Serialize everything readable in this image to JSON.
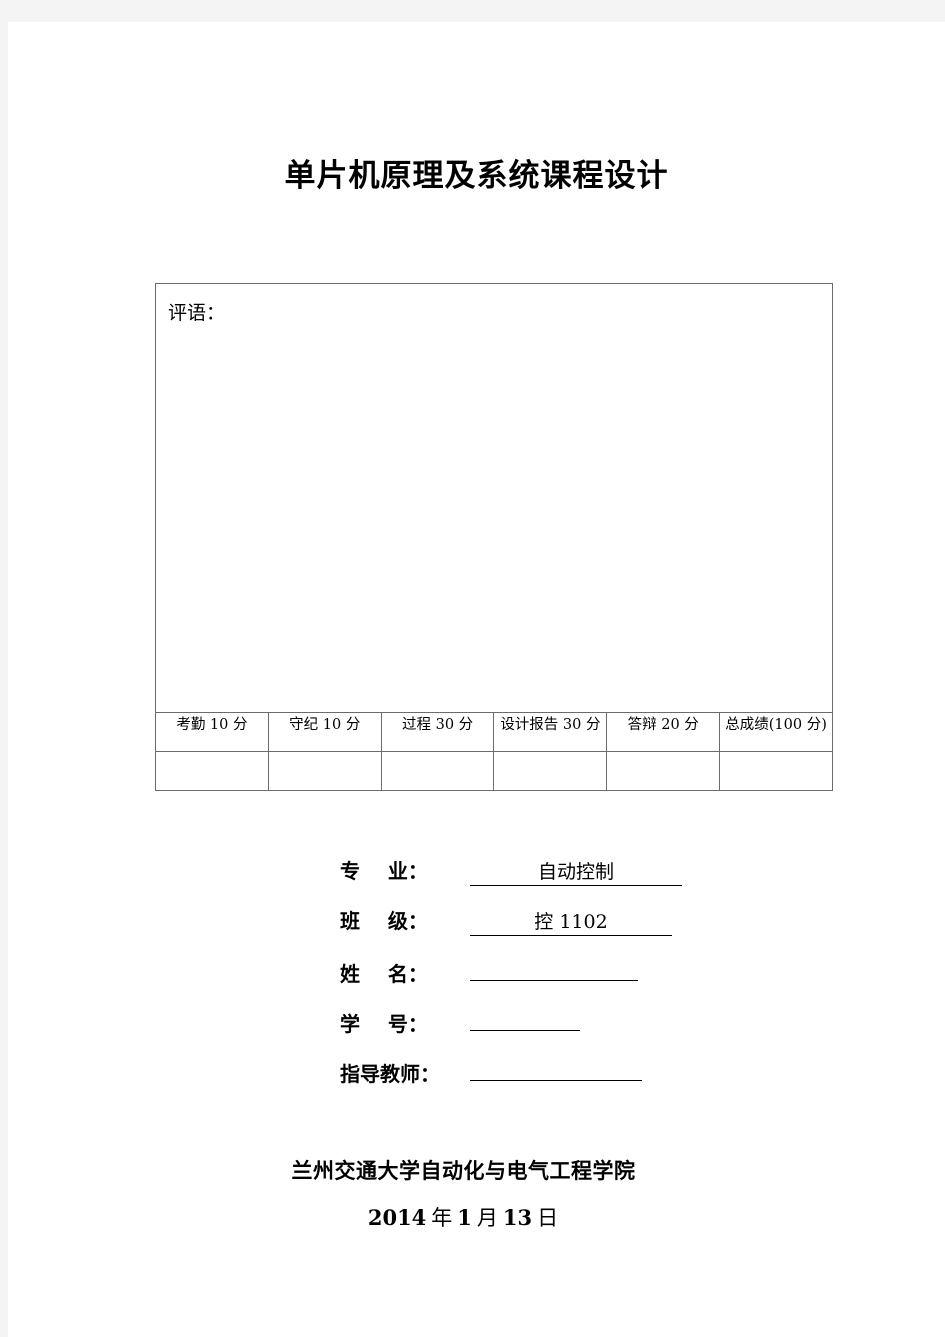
{
  "document": {
    "title": "单片机原理及系统课程设计"
  },
  "evaluation_table": {
    "comment_label": "评语：",
    "score_headers": [
      "考勤 10 分",
      "守纪 10 分",
      "过程 30 分",
      "设计报告 30 分",
      "答辩 20 分",
      "总成绩(100 分)"
    ],
    "score_values": [
      "",
      "",
      "",
      "",
      "",
      ""
    ]
  },
  "info_fields": [
    {
      "label": "专    业：",
      "value": "自动控制"
    },
    {
      "label": "班    级：",
      "value": "控 1102"
    },
    {
      "label": "姓    名：",
      "value": ""
    },
    {
      "label": "学    号：",
      "value": ""
    },
    {
      "label": "指导教师：",
      "value": ""
    }
  ],
  "footer": {
    "school": "兰州交通大学自动化与电气工程学院",
    "date": {
      "year": "2014",
      "year_unit": "年",
      "month": "1",
      "month_unit": "月",
      "day": "13",
      "day_unit": "日"
    }
  }
}
